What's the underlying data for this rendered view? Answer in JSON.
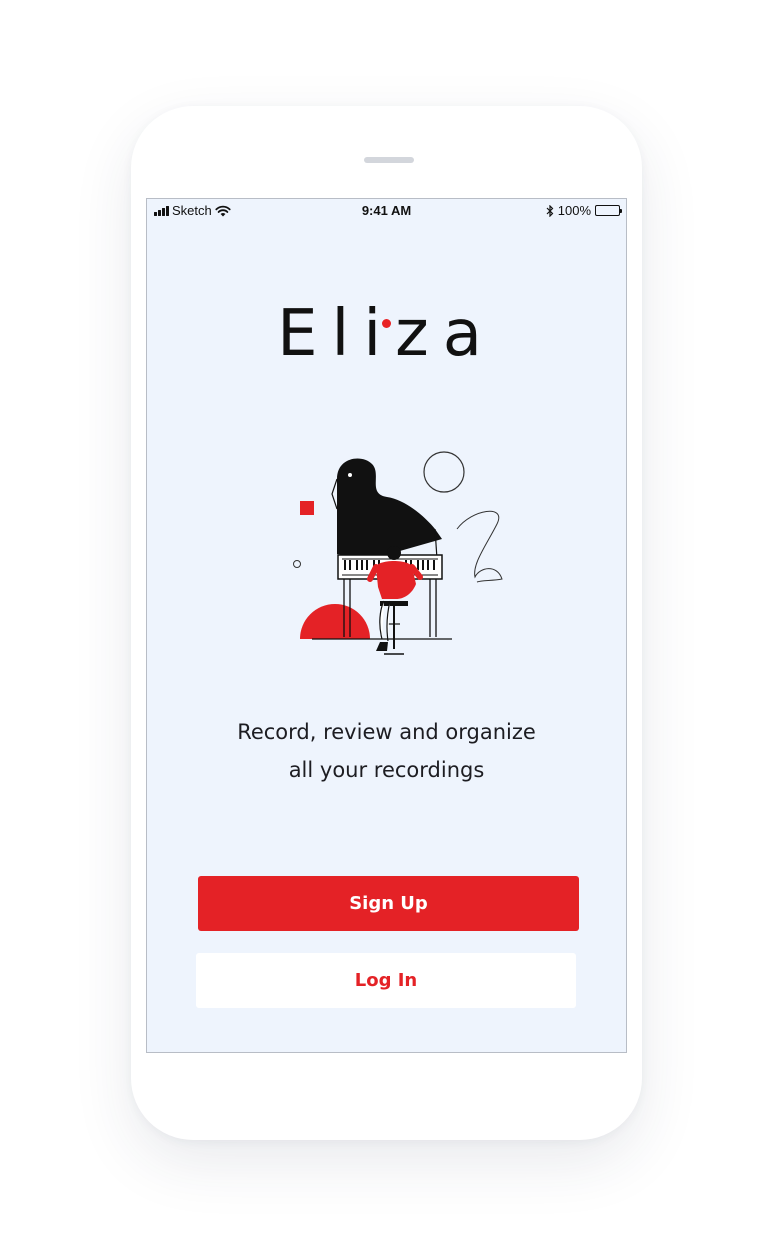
{
  "status_bar": {
    "carrier": "Sketch",
    "time": "9:41 AM",
    "battery": "100%"
  },
  "app": {
    "logo": "Eliza",
    "tagline_line1": "Record, review and organize",
    "tagline_line2": "all your recordings"
  },
  "buttons": {
    "signup": "Sign Up",
    "login": "Log In"
  },
  "colors": {
    "accent": "#e42226",
    "screen_bg": "#eef4fd",
    "text": "#111111"
  },
  "icons": [
    "signal-icon",
    "wifi-icon",
    "bluetooth-icon",
    "battery-icon",
    "piano-illustration"
  ]
}
